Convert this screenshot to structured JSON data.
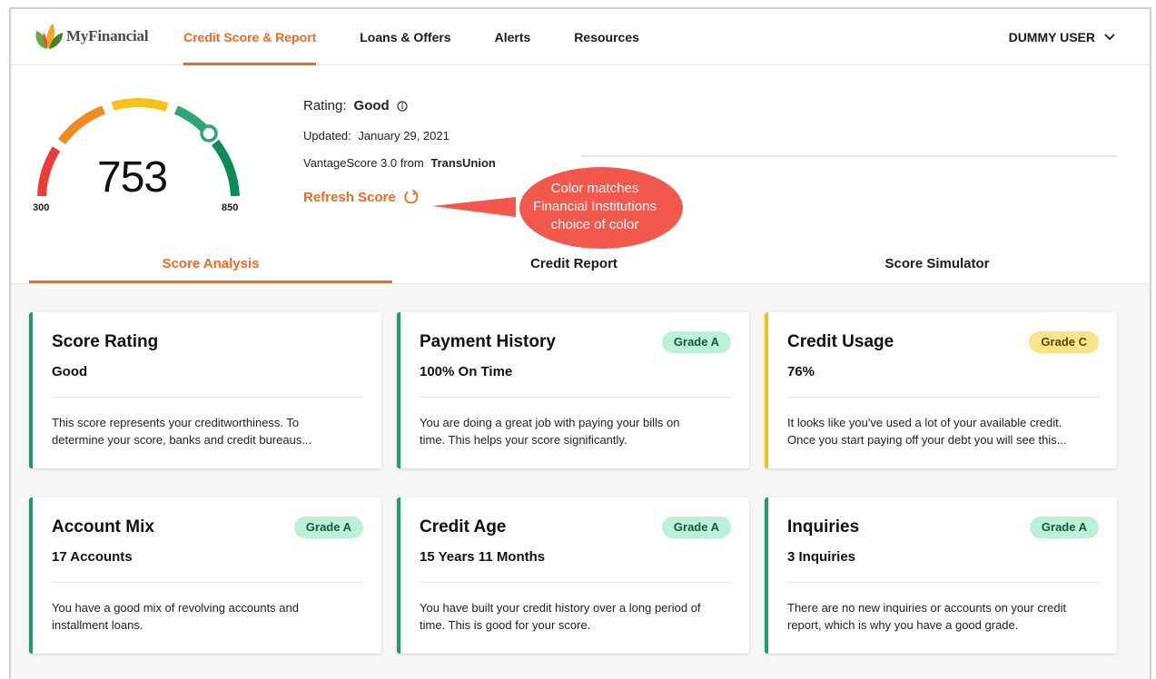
{
  "header": {
    "logo_text": "MyFinancial",
    "nav": [
      {
        "label": "Credit Score & Report"
      },
      {
        "label": "Loans & Offers"
      },
      {
        "label": "Alerts"
      },
      {
        "label": "Resources"
      }
    ],
    "user": "DUMMY USER"
  },
  "score": {
    "value": "753",
    "min": "300",
    "max": "850",
    "rating_label": "Rating:",
    "rating_value": "Good",
    "updated_label": "Updated:",
    "updated_value": "January 29, 2021",
    "model": "VantageScore 3.0 from",
    "source": "TransUnion",
    "refresh_label": "Refresh Score"
  },
  "callout": {
    "line1": "Color matches",
    "line2": "Financial Institutions",
    "line3": "choice of color"
  },
  "tabs": [
    {
      "label": "Score Analysis"
    },
    {
      "label": "Credit Report"
    },
    {
      "label": "Score Simulator"
    }
  ],
  "cards": [
    {
      "title": "Score Rating",
      "value": "Good",
      "grade": "",
      "desc_1": "This score represents your creditworthiness. To",
      "desc_2": "determine your score, banks and credit bureaus..."
    },
    {
      "title": "Payment History",
      "value": "100% On Time",
      "grade": "Grade A",
      "desc_1": "You are doing a great job with paying your bills on",
      "desc_2": "time. This helps your score significantly."
    },
    {
      "title": "Credit Usage",
      "value": "76%",
      "grade": "Grade C",
      "desc_1": "It looks like you've used a lot of your available credit.",
      "desc_2": "Once you start paying off your debt you will see this..."
    },
    {
      "title": "Account Mix",
      "value": "17 Accounts",
      "grade": "Grade A",
      "desc_1": "You have a good mix of revolving accounts and",
      "desc_2": "installment loans."
    },
    {
      "title": "Credit Age",
      "value": "15 Years 11 Months",
      "grade": "Grade A",
      "desc_1": "You have built your credit history over a long period of",
      "desc_2": "time. This is good for your score."
    },
    {
      "title": "Inquiries",
      "value": "3 Inquiries",
      "grade": "Grade A",
      "desc_1": "There are no new inquiries or accounts on your credit",
      "desc_2": "report, which is why you have a good grade."
    }
  ],
  "colors": {
    "accent": "#f26a21",
    "grade_a_bg": "#bdf0d8",
    "grade_c_bg": "#fbe38a",
    "good_border": "#1a9e6b",
    "warn_border": "#f3c318",
    "callout": "#f2594c"
  },
  "icons": [
    "logo-leaf-icon",
    "chevron-down-icon",
    "info-icon",
    "refresh-icon"
  ]
}
